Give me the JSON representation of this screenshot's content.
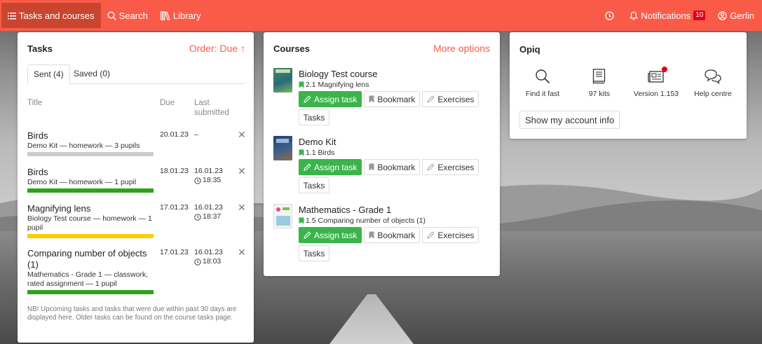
{
  "nav": {
    "tasks_courses": "Tasks and courses",
    "search": "Search",
    "library": "Library",
    "notifications": "Notifications",
    "notifications_count": "10",
    "user": "Gerlin"
  },
  "tasks": {
    "title": "Tasks",
    "order": "Order: Due",
    "tabs": {
      "sent": "Sent (4)",
      "saved": "Saved (0)"
    },
    "columns": {
      "title": "Title",
      "due": "Due",
      "last": "Last submitted"
    },
    "rows": [
      {
        "title": "Birds",
        "sub": "Demo Kit — homework — 3 pupils",
        "due": "20.01.23",
        "last_date": "–",
        "last_time": "",
        "bar_color": "#cccccc"
      },
      {
        "title": "Birds",
        "sub": "Demo Kit — homework — 1 pupil",
        "due": "18.01.23",
        "last_date": "16.01.23",
        "last_time": "18:35",
        "bar_color": "#2ea31a"
      },
      {
        "title": "Magnifying lens",
        "sub": "Biology Test course — homework — 1 pupil",
        "due": "17.01.23",
        "last_date": "16.01.23",
        "last_time": "18:37",
        "bar_color": "#ffcc00"
      },
      {
        "title": "Comparing number of objects (1)",
        "sub": "Mathematics - Grade 1 — classwork, rated assignment — 1 pupil",
        "due": "17.01.23",
        "last_date": "16.01.23",
        "last_time": "18:03",
        "bar_color": "#2ea31a"
      }
    ],
    "note": "NB! Upcoming tasks and tasks that were due within past 30 days are displayed here. Older tasks can be found on the course tasks page."
  },
  "courses": {
    "title": "Courses",
    "more": "More options",
    "buttons": {
      "assign": "Assign task",
      "bookmark": "Bookmark",
      "exercises": "Exercises",
      "tasks": "Tasks"
    },
    "items": [
      {
        "name": "Biology Test course",
        "sub": "2.1 Magnifying lens"
      },
      {
        "name": "Demo Kit",
        "sub": "1.1 Birds"
      },
      {
        "name": "Mathematics - Grade 1",
        "sub": "1.5 Comparing number of objects (1)"
      }
    ]
  },
  "opiq": {
    "title": "Opiq",
    "items": [
      {
        "label": "Find it fast",
        "icon": "search-icon"
      },
      {
        "label": "97 kits",
        "icon": "book-icon"
      },
      {
        "label": "Version 1.153",
        "icon": "news-icon"
      },
      {
        "label": "Help centre",
        "icon": "chat-icon"
      }
    ],
    "account_button": "Show my account info"
  },
  "colors": {
    "brand": "#fa5b48",
    "green": "#39b54a",
    "badge": "#e0001b"
  }
}
